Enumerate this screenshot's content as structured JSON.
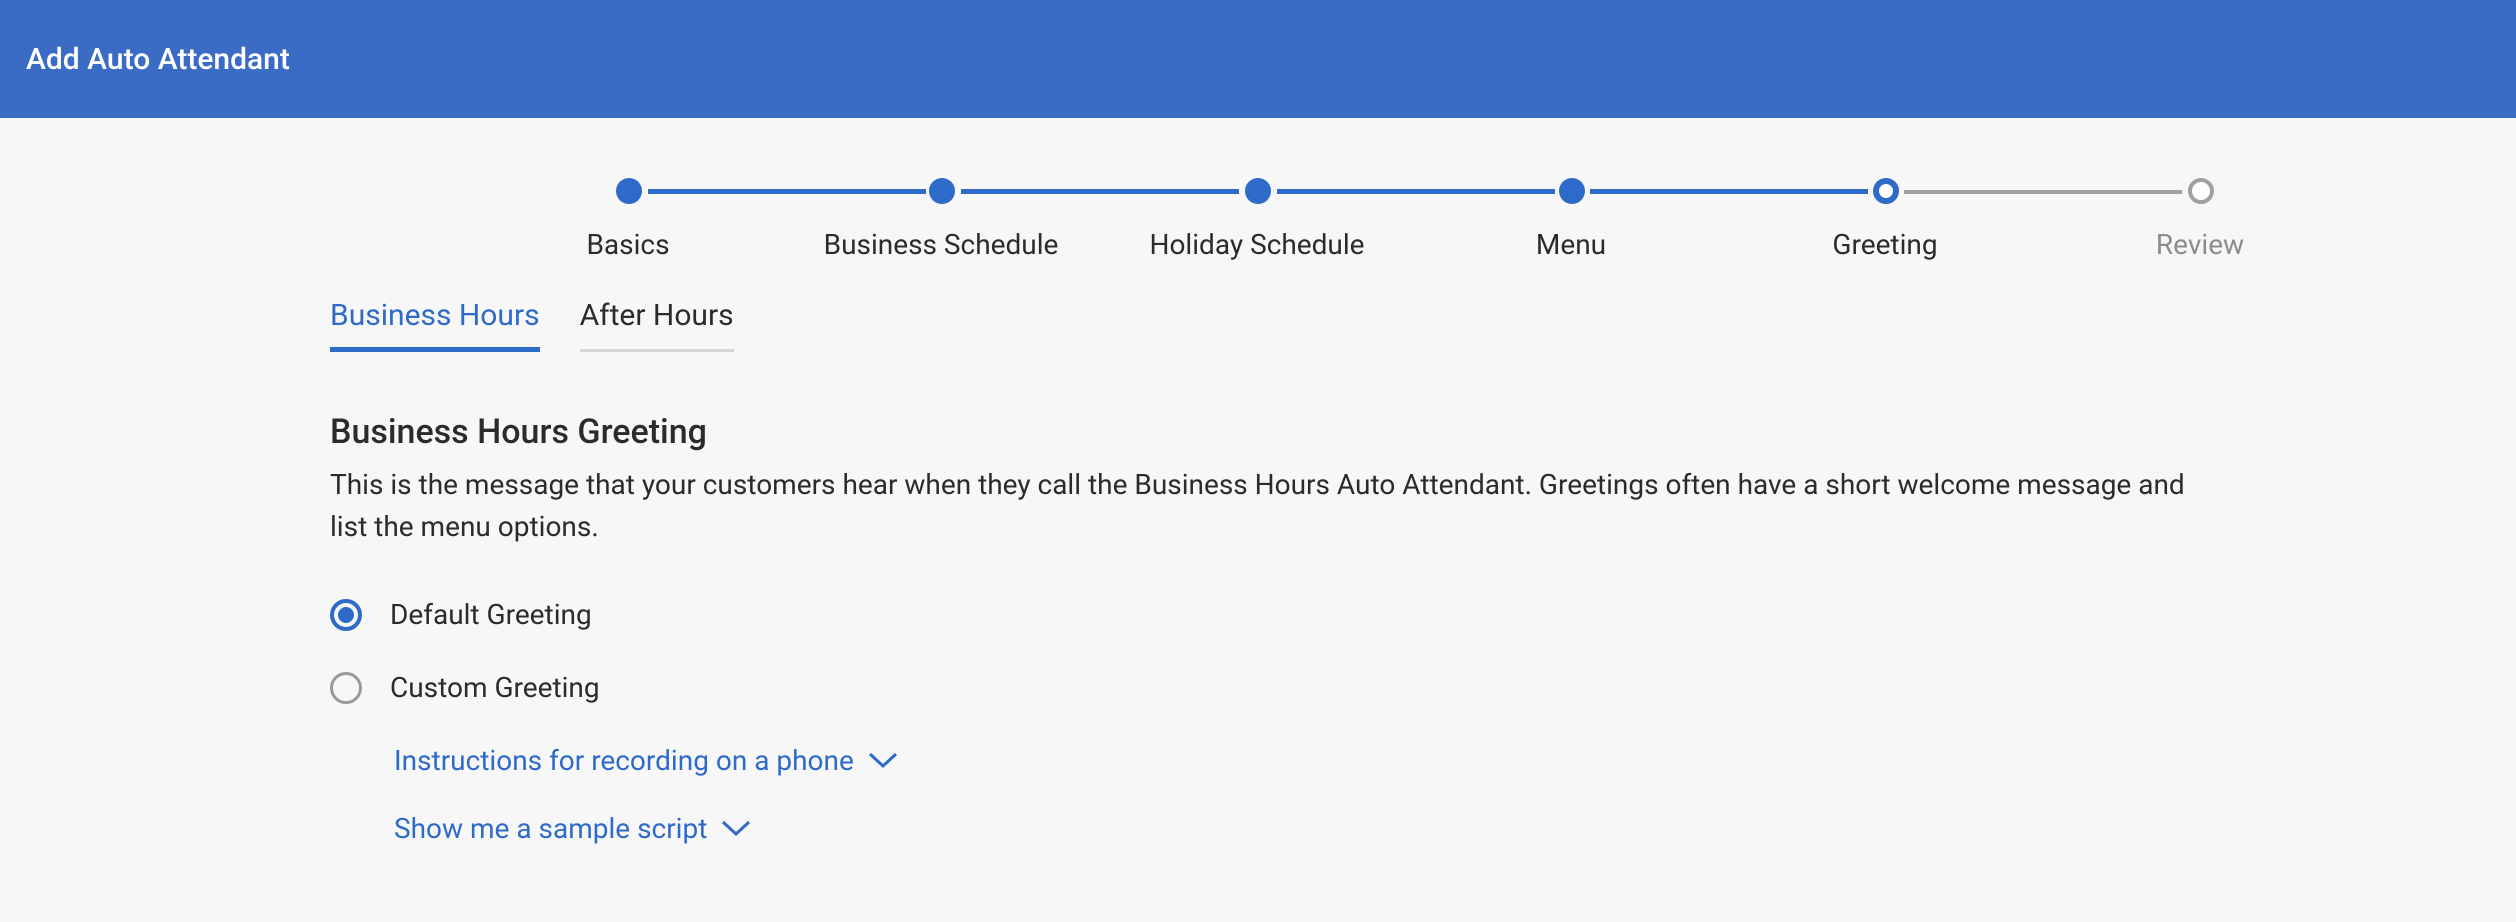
{
  "header": {
    "title": "Add Auto Attendant"
  },
  "stepper": {
    "steps": [
      {
        "label": "Basics"
      },
      {
        "label": "Business Schedule"
      },
      {
        "label": "Holiday Schedule"
      },
      {
        "label": "Menu"
      },
      {
        "label": "Greeting"
      },
      {
        "label": "Review"
      }
    ]
  },
  "tabs": {
    "business_hours": "Business Hours",
    "after_hours": "After Hours"
  },
  "section": {
    "title": "Business Hours Greeting",
    "description": "This is the message that your customers hear when they call the Business Hours Auto Attendant. Greetings often have a short welcome message and list the menu options."
  },
  "options": {
    "default_greeting": "Default Greeting",
    "custom_greeting": "Custom Greeting"
  },
  "links": {
    "recording_instructions": "Instructions for recording on a phone",
    "sample_script": "Show me a sample script"
  }
}
